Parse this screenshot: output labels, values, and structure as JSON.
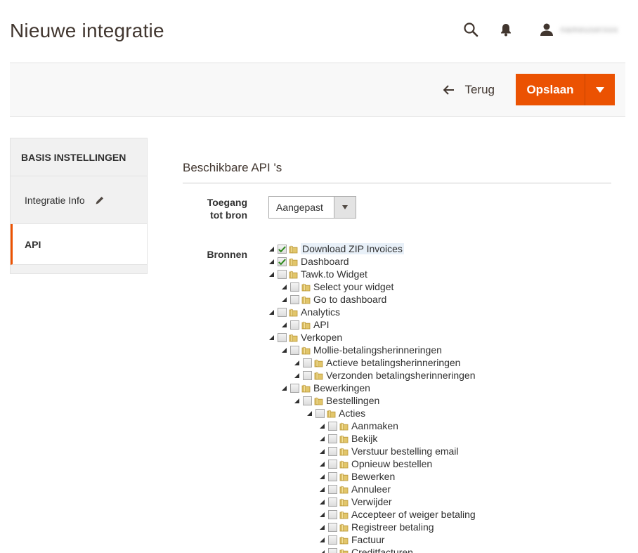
{
  "page": {
    "title": "Nieuwe integratie",
    "user_name": "nameuserxxx"
  },
  "toolbar": {
    "back_label": "Terug",
    "save_label": "Opslaan"
  },
  "colors": {
    "accent": "#eb5202",
    "check": "#2f8a1e"
  },
  "sidebar": {
    "title": "BASIS INSTELLINGEN",
    "items": [
      {
        "label": "Integratie Info"
      },
      {
        "label": "API"
      }
    ]
  },
  "section": {
    "title": "Beschikbare API 's",
    "access_label_line1": "Toegang",
    "access_label_line2": "tot bron",
    "access_value": "Aangepast",
    "resources_label": "Bronnen"
  },
  "tree": [
    {
      "label": "Download ZIP Invoices",
      "level": 0,
      "checked": true,
      "highlight": true
    },
    {
      "label": "Dashboard",
      "level": 0,
      "checked": true
    },
    {
      "label": "Tawk.to Widget",
      "level": 0,
      "checked": false
    },
    {
      "label": "Select your widget",
      "level": 1,
      "checked": false
    },
    {
      "label": "Go to dashboard",
      "level": 1,
      "checked": false
    },
    {
      "label": "Analytics",
      "level": 0,
      "checked": false
    },
    {
      "label": "API",
      "level": 1,
      "checked": false
    },
    {
      "label": "Verkopen",
      "level": 0,
      "checked": false
    },
    {
      "label": "Mollie-betalingsherinneringen",
      "level": 1,
      "checked": false
    },
    {
      "label": "Actieve betalingsherinneringen",
      "level": 2,
      "checked": false
    },
    {
      "label": "Verzonden betalingsherinneringen",
      "level": 2,
      "checked": false
    },
    {
      "label": "Bewerkingen",
      "level": 1,
      "checked": false
    },
    {
      "label": "Bestellingen",
      "level": 2,
      "checked": false
    },
    {
      "label": "Acties",
      "level": 3,
      "checked": false
    },
    {
      "label": "Aanmaken",
      "level": 4,
      "checked": false
    },
    {
      "label": "Bekijk",
      "level": 4,
      "checked": false
    },
    {
      "label": "Verstuur bestelling email",
      "level": 4,
      "checked": false
    },
    {
      "label": "Opnieuw bestellen",
      "level": 4,
      "checked": false
    },
    {
      "label": "Bewerken",
      "level": 4,
      "checked": false
    },
    {
      "label": "Annuleer",
      "level": 4,
      "checked": false
    },
    {
      "label": "Verwijder",
      "level": 4,
      "checked": false
    },
    {
      "label": "Accepteer of weiger betaling",
      "level": 4,
      "checked": false
    },
    {
      "label": "Registreer betaling",
      "level": 4,
      "checked": false
    },
    {
      "label": "Factuur",
      "level": 4,
      "checked": false
    },
    {
      "label": "Creditfacturen",
      "level": 4,
      "checked": false
    }
  ]
}
